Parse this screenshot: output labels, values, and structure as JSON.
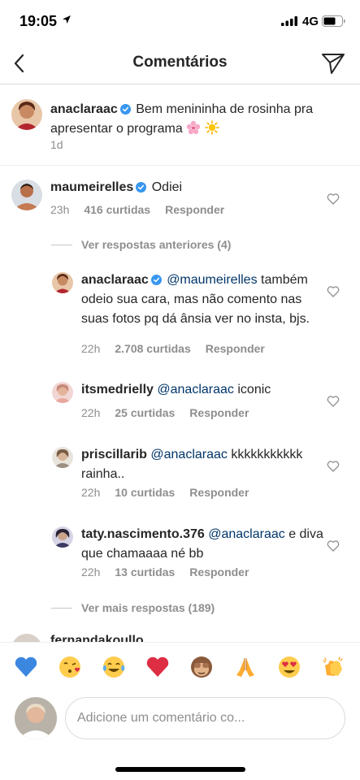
{
  "status_bar": {
    "time": "19:05",
    "network": "4G"
  },
  "nav": {
    "title": "Comentários"
  },
  "caption": {
    "username": "anaclaraac",
    "text": "Bem menininha de rosinha pra apresentar o programa",
    "time": "1d"
  },
  "comments": [
    {
      "username": "maumeirelles",
      "verified": true,
      "mention": "",
      "text": "Odiei",
      "time": "23h",
      "likes": "416 curtidas",
      "reply": "Responder"
    }
  ],
  "view_previous": "Ver respostas anteriores (4)",
  "replies": [
    {
      "username": "anaclaraac",
      "verified": true,
      "mention": "@maumeirelles",
      "text": "também odeio sua cara, mas não comento nas suas fotos pq dá ânsia ver no insta, bjs.",
      "time": "22h",
      "likes": "2.708 curtidas",
      "reply": "Responder"
    },
    {
      "username": "itsmedrielly",
      "verified": false,
      "mention": "@anaclaraac",
      "text": "iconic",
      "time": "22h",
      "likes": "25 curtidas",
      "reply": "Responder"
    },
    {
      "username": "priscillarib",
      "verified": false,
      "mention": "@anaclaraac",
      "text": "kkkkkkkkkkk rainha..",
      "time": "22h",
      "likes": "10 curtidas",
      "reply": "Responder"
    },
    {
      "username": "taty.nascimento.376",
      "verified": false,
      "mention": "@anaclaraac",
      "text": "e diva que chamaaaa né bb",
      "time": "22h",
      "likes": "13 curtidas",
      "reply": "Responder"
    }
  ],
  "view_more": "Ver mais respostas (189)",
  "next_comment_peek": "fernandakoullo",
  "emoji_bar": [
    "blue-heart",
    "kissing-face",
    "tears-of-joy",
    "red-heart",
    "see-no-evil-monkey",
    "folded-hands",
    "heart-eyes",
    "clapping-hands"
  ],
  "input": {
    "placeholder": "Adicione um comentário co..."
  },
  "colors": {
    "text": "#262626",
    "secondary": "#8e8e8e",
    "mention": "#003569",
    "verified": "#3897f0",
    "divider": "#dbdbdb"
  }
}
